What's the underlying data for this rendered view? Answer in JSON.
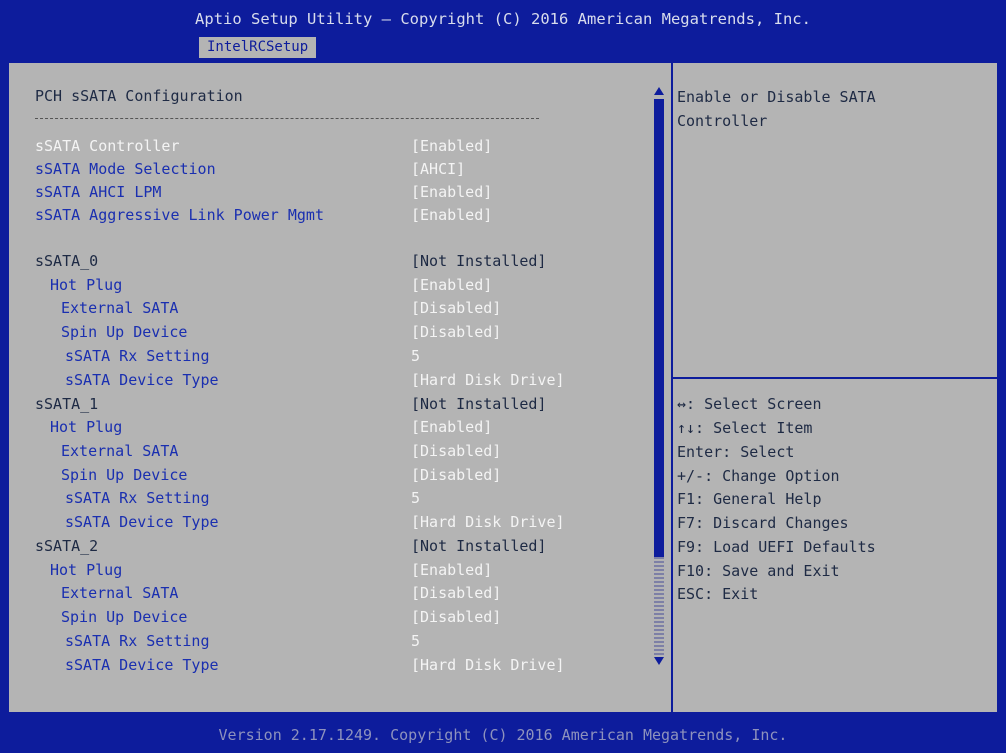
{
  "header": {
    "title": "Aptio Setup Utility – Copyright (C) 2016 American Megatrends, Inc.",
    "tab": "IntelRCSetup"
  },
  "main": {
    "title": "PCH sSATA Configuration",
    "settings": [
      {
        "label": "sSATA Controller",
        "value": "[Enabled]"
      },
      {
        "label": "sSATA Mode Selection",
        "value": "[AHCI]"
      },
      {
        "label": "sSATA AHCI LPM",
        "value": "[Enabled]"
      },
      {
        "label": "sSATA Aggressive Link Power Mgmt",
        "value": "[Enabled]"
      }
    ],
    "ports": [
      {
        "name": "sSATA_0",
        "status": "[Not Installed]",
        "hot_plug": {
          "label": "Hot Plug",
          "value": "[Enabled]"
        },
        "external_sata": {
          "label": "External SATA",
          "value": "[Disabled]"
        },
        "spin_up": {
          "label": "Spin Up Device",
          "value": "[Disabled]"
        },
        "rx_setting": {
          "label": "sSATA Rx Setting",
          "value": "5"
        },
        "device_type": {
          "label": "sSATA Device Type",
          "value": "[Hard Disk Drive]"
        }
      },
      {
        "name": "sSATA_1",
        "status": "[Not Installed]",
        "hot_plug": {
          "label": "Hot Plug",
          "value": "[Enabled]"
        },
        "external_sata": {
          "label": "External SATA",
          "value": "[Disabled]"
        },
        "spin_up": {
          "label": "Spin Up Device",
          "value": "[Disabled]"
        },
        "rx_setting": {
          "label": "sSATA Rx Setting",
          "value": "5"
        },
        "device_type": {
          "label": "sSATA Device Type",
          "value": "[Hard Disk Drive]"
        }
      },
      {
        "name": "sSATA_2",
        "status": "[Not Installed]",
        "hot_plug": {
          "label": "Hot Plug",
          "value": "[Enabled]"
        },
        "external_sata": {
          "label": "External SATA",
          "value": "[Disabled]"
        },
        "spin_up": {
          "label": "Spin Up Device",
          "value": "[Disabled]"
        },
        "rx_setting": {
          "label": "sSATA Rx Setting",
          "value": "5"
        },
        "device_type": {
          "label": "sSATA Device Type",
          "value": "[Hard Disk Drive]"
        }
      }
    ]
  },
  "help": {
    "lines": [
      "Enable or Disable SATA",
      "Controller"
    ]
  },
  "keys": [
    "↔: Select Screen",
    "↑↓: Select Item",
    "Enter: Select",
    "+/-: Change Option",
    "F1: General Help",
    "F7: Discard Changes",
    "F9: Load UEFI Defaults",
    "F10: Save and Exit",
    "ESC: Exit"
  ],
  "footer": {
    "text": "Version 2.17.1249. Copyright (C) 2016 American Megatrends, Inc."
  },
  "colors": {
    "frame_blue": "#0d1c9c",
    "panel_gray": "#b4b4b4",
    "selected_text": "#f4f4f4",
    "option_text": "#1a2fb0",
    "static_text": "#1e2a44"
  }
}
